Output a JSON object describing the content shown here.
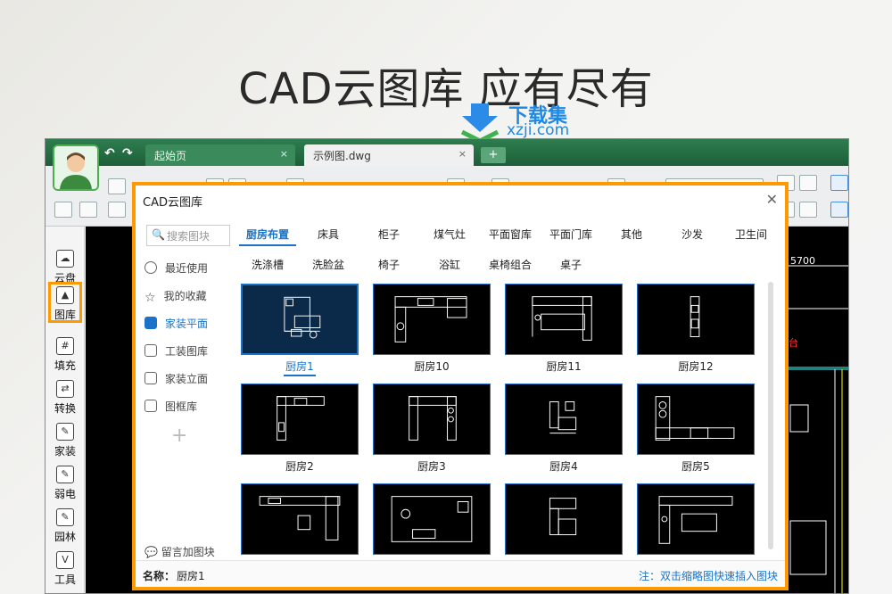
{
  "headline": "CAD云图库  应有尽有",
  "watermark": {
    "name": "下载集",
    "url": "xzji.com"
  },
  "tabs": [
    {
      "label": "起始页",
      "close": "×"
    },
    {
      "label": "示例图.dwg",
      "close": "×"
    }
  ],
  "tab_add": "+",
  "nav": {
    "back": "↶",
    "forward": "↷"
  },
  "left_toolbar": [
    {
      "label": "云盘",
      "icon": "cloud-icon"
    },
    {
      "label": "图库",
      "icon": "gallery-icon"
    },
    {
      "label": "填充",
      "icon": "hatch-icon"
    },
    {
      "label": "转换",
      "icon": "convert-icon"
    },
    {
      "label": "家装",
      "icon": "home-icon"
    },
    {
      "label": "弱电",
      "icon": "weak-current-icon"
    },
    {
      "label": "园林",
      "icon": "garden-icon"
    },
    {
      "label": "工具",
      "icon": "tools-icon"
    }
  ],
  "canvas": {
    "dim_text": "5700",
    "red_text": "台"
  },
  "dialog": {
    "title": "CAD云图库",
    "close": "✕",
    "search_placeholder": "搜索图块",
    "sidebar": [
      {
        "label": "最近使用",
        "icon": "clock-icon"
      },
      {
        "label": "我的收藏",
        "icon": "star-icon"
      },
      {
        "label": "家装平面",
        "icon": "image-icon"
      },
      {
        "label": "工装图库",
        "icon": "image-icon"
      },
      {
        "label": "家装立面",
        "icon": "image-icon"
      },
      {
        "label": "图框库",
        "icon": "image-icon"
      }
    ],
    "add": "+",
    "message": "留言加图块",
    "categories_row1": [
      "厨房布置",
      "床具",
      "柜子",
      "煤气灶",
      "平面窗库",
      "平面门库",
      "其他",
      "沙发",
      "卫生间"
    ],
    "categories_row2": [
      "洗涤槽",
      "洗脸盆",
      "椅子",
      "浴缸",
      "桌椅组合",
      "桌子"
    ],
    "items": [
      "厨房1",
      "厨房10",
      "厨房11",
      "厨房12",
      "厨房2",
      "厨房3",
      "厨房4",
      "厨房5",
      "",
      "",
      "",
      ""
    ],
    "footer": {
      "name_label": "名称：",
      "name_value": "厨房1",
      "tip": "注：双击缩略图快速插入图块"
    }
  },
  "colors": {
    "accent": "#1a73c8",
    "highlight": "#ff9900",
    "tabbar": "#2e7d4f"
  }
}
